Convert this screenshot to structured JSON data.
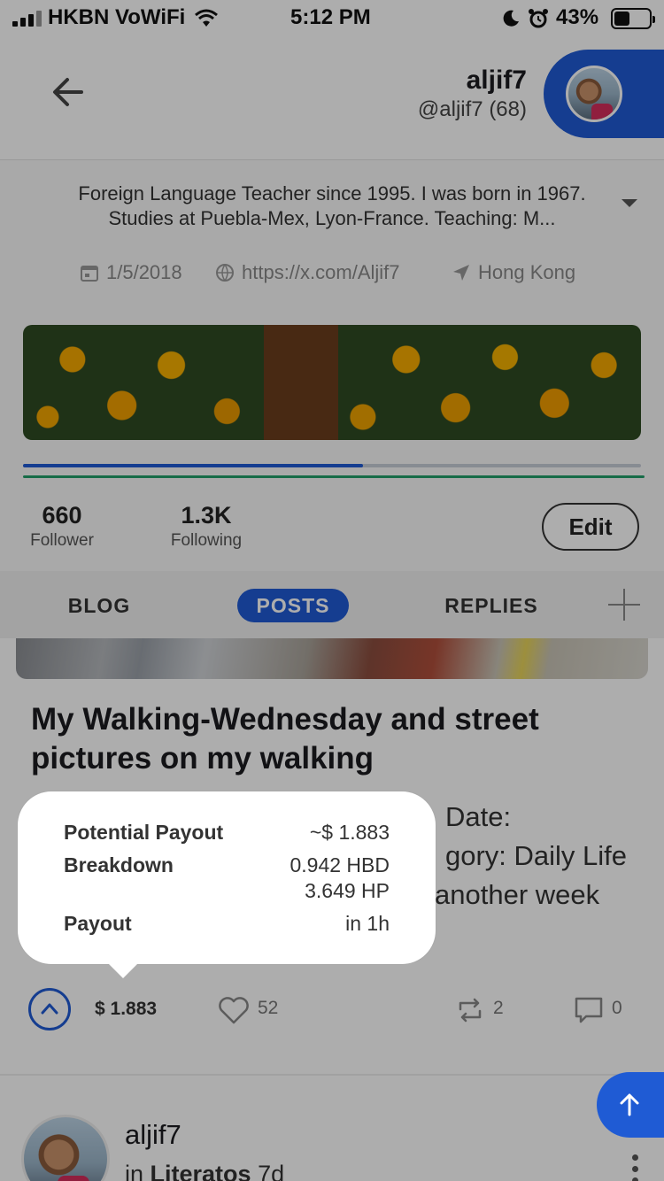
{
  "status_bar": {
    "carrier": "HKBN VoWiFi",
    "time": "5:12 PM",
    "battery": "43%"
  },
  "header": {
    "username": "aljif7",
    "handle": "@aljif7 (68)"
  },
  "profile": {
    "bio": "Foreign Language Teacher since 1995. I was born in 1967. Studies at Puebla-Mex, Lyon-France. Teaching: M...",
    "joined": "1/5/2018",
    "website": "https://x.com/Aljif7",
    "location": "Hong Kong",
    "followers_count": "660",
    "followers_label": "Follower",
    "following_count": "1.3K",
    "following_label": "Following",
    "edit_label": "Edit",
    "voting_power": 0.55
  },
  "tabs": [
    {
      "label": "BLOG",
      "active": false
    },
    {
      "label": "POSTS",
      "active": true
    },
    {
      "label": "REPLIES",
      "active": false
    }
  ],
  "post": {
    "title": "My Walking-Wednesday and street pictures on my walking",
    "body_line1": "Date:",
    "body_line2": "gory: Daily Life",
    "body_line3": "another week",
    "payout": "$ 1.883",
    "likes": "52",
    "reblogs": "2",
    "comments": "0"
  },
  "tooltip": {
    "potential_label": "Potential Payout",
    "potential_value": "~$ 1.883",
    "breakdown_label": "Breakdown",
    "breakdown_hbd": "0.942 HBD",
    "breakdown_hp": "3.649 HP",
    "payout_label": "Payout",
    "payout_value": "in 1h"
  },
  "next_post": {
    "author": "aljif7",
    "community_prefix": "in",
    "community": "Literatos",
    "age": "7d"
  },
  "colors": {
    "accent": "#1f5bd4",
    "green_bar": "#22a06b"
  }
}
